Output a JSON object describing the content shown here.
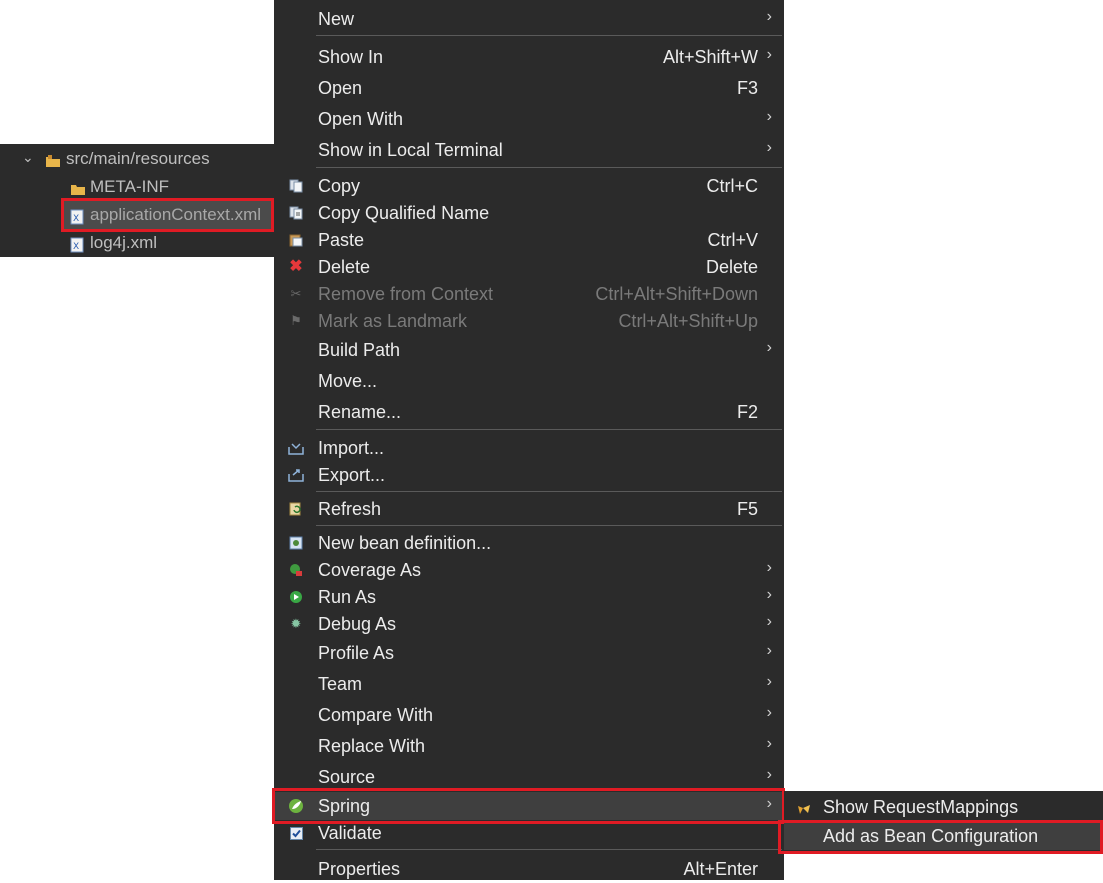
{
  "tree": {
    "items": [
      {
        "label": "src/main/resources",
        "icon": "package-folder-icon",
        "expanded": true
      },
      {
        "label": "META-INF",
        "icon": "folder-icon"
      },
      {
        "label": "applicationContext.xml",
        "icon": "xml-file-icon",
        "selected": true
      },
      {
        "label": "log4j.xml",
        "icon": "xml-file-icon"
      }
    ]
  },
  "menu": {
    "items": [
      {
        "label": "New",
        "submenu": true
      },
      {
        "label": "Show In",
        "accel": "Alt+Shift+W",
        "submenu": true
      },
      {
        "label": "Open",
        "accel": "F3"
      },
      {
        "label": "Open With",
        "submenu": true
      },
      {
        "label": "Show in Local Terminal",
        "submenu": true
      },
      {
        "label": "Copy",
        "accel": "Ctrl+C",
        "icon": "copy-icon"
      },
      {
        "label": "Copy Qualified Name",
        "icon": "copy-qualified-name-icon"
      },
      {
        "label": "Paste",
        "accel": "Ctrl+V",
        "icon": "paste-icon"
      },
      {
        "label": "Delete",
        "accel": "Delete",
        "icon": "delete-icon"
      },
      {
        "label": "Remove from Context",
        "accel": "Ctrl+Alt+Shift+Down",
        "disabled": true,
        "icon": "remove-context-icon"
      },
      {
        "label": "Mark as Landmark",
        "accel": "Ctrl+Alt+Shift+Up",
        "disabled": true,
        "icon": "landmark-icon"
      },
      {
        "label": "Build Path",
        "submenu": true
      },
      {
        "label": "Move..."
      },
      {
        "label": "Rename...",
        "accel": "F2"
      },
      {
        "label": "Import...",
        "icon": "import-icon"
      },
      {
        "label": "Export...",
        "icon": "export-icon"
      },
      {
        "label": "Refresh",
        "accel": "F5",
        "icon": "refresh-icon"
      },
      {
        "label": "New bean definition...",
        "icon": "bean-definition-icon"
      },
      {
        "label": "Coverage As",
        "submenu": true,
        "icon": "coverage-icon"
      },
      {
        "label": "Run As",
        "submenu": true,
        "icon": "run-icon"
      },
      {
        "label": "Debug As",
        "submenu": true,
        "icon": "debug-icon"
      },
      {
        "label": "Profile As",
        "submenu": true
      },
      {
        "label": "Team",
        "submenu": true
      },
      {
        "label": "Compare With",
        "submenu": true
      },
      {
        "label": "Replace With",
        "submenu": true
      },
      {
        "label": "Source",
        "submenu": true
      },
      {
        "label": "Spring",
        "submenu": true,
        "highlighted": true,
        "icon": "spring-icon"
      },
      {
        "label": "Validate",
        "icon": "validate-icon"
      },
      {
        "label": "Properties",
        "accel": "Alt+Enter"
      }
    ]
  },
  "submenu": {
    "items": [
      {
        "label": "Show RequestMappings",
        "icon": "request-mappings-icon"
      },
      {
        "label": "Add as Bean Configuration",
        "highlighted": true
      }
    ]
  },
  "colors": {
    "menu_bg": "#2b2b2b",
    "highlight_box": "#e01b24",
    "text": "#ececec",
    "disabled_text": "#7a7a7a"
  }
}
